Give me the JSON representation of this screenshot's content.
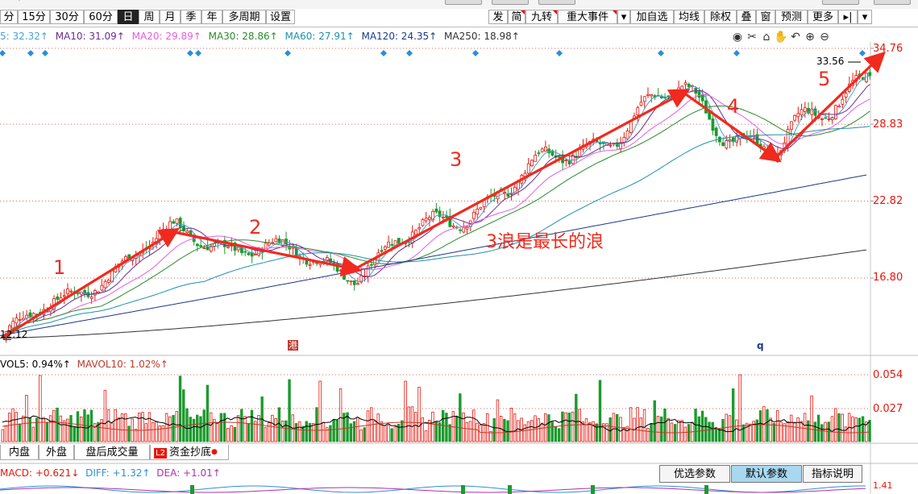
{
  "toolbar": {
    "periods": [
      "分",
      "15分",
      "30分",
      "60分",
      "日",
      "周",
      "月",
      "季",
      "年",
      "多周期",
      "设置"
    ],
    "selected_period": "日",
    "right_buttons": [
      "发",
      "简",
      "九转",
      "重大事件",
      "▾",
      "加自选",
      "均线",
      "除权",
      "叠",
      "窗",
      "预测",
      "更多",
      "▸|",
      "▾"
    ]
  },
  "ma_legend": [
    {
      "label": "5: 32.32↑",
      "color": "#4a9fd8"
    },
    {
      "label": "MA10: 31.09↑",
      "color": "#6d2b8f"
    },
    {
      "label": "MA20: 29.89↑",
      "color": "#e85de0"
    },
    {
      "label": "MA30: 28.86↑",
      "color": "#2a8c2a"
    },
    {
      "label": "MA60: 27.91↑",
      "color": "#1f8fb0"
    },
    {
      "label": "MA120: 24.35↑",
      "color": "#1a3a8a"
    },
    {
      "label": "MA250: 18.98↑",
      "color": "#333333"
    }
  ],
  "tool_icons": [
    "eye-icon",
    "scissors-icon",
    "lock-icon",
    "hand-icon",
    "undo-icon",
    "zoom-in-icon",
    "zoom-out-icon"
  ],
  "price_axis": {
    "labels": [
      "34.76",
      "28.83",
      "22.82",
      "16.80"
    ]
  },
  "price_marks": {
    "low": "12.12",
    "high": "33.56"
  },
  "wave_labels": {
    "w1": "1",
    "w2": "2",
    "w3": "3",
    "w4": "4",
    "w5": "5",
    "note": "3浪是最长的浪"
  },
  "chart_marks": {
    "gang": "港",
    "q": "q"
  },
  "volume": {
    "legend": [
      {
        "label": "VOL5: 0.94%↑",
        "color": "#000000"
      },
      {
        "label": "MAVOL10: 1.02%↑",
        "color": "#c0392b"
      }
    ],
    "axis": [
      "0.054",
      "0.027"
    ]
  },
  "tabs": [
    "内盘",
    "外盘",
    "盘后成交量",
    "资金抄底"
  ],
  "macd": {
    "legend": [
      {
        "label": "MACD: +0.621↓",
        "color": "#e8160c"
      },
      {
        "label": "DIFF: +1.32↑",
        "color": "#2e8fd6"
      },
      {
        "label": "DEA: +1.01↑",
        "color": "#b030b0"
      }
    ],
    "buttons": [
      "优选参数",
      "默认参数",
      "指标说明"
    ],
    "selected": "默认参数",
    "axis": "1.41"
  },
  "chart_data": {
    "type": "candlestick",
    "title": "",
    "ylim": [
      11.5,
      36.0
    ],
    "yticks": [
      16.8,
      22.82,
      28.83,
      34.76
    ],
    "low_mark": 12.12,
    "high_mark": 33.56,
    "waves": [
      {
        "label": "1",
        "from": 12.2,
        "to": 20.4
      },
      {
        "label": "2",
        "from": 20.4,
        "to": 17.5
      },
      {
        "label": "3",
        "from": 17.5,
        "to": 31.3
      },
      {
        "label": "4",
        "from": 31.3,
        "to": 26.2
      },
      {
        "label": "5",
        "from": 26.2,
        "to": 33.6
      }
    ],
    "volume_yticks": [
      0.027,
      0.054
    ]
  }
}
